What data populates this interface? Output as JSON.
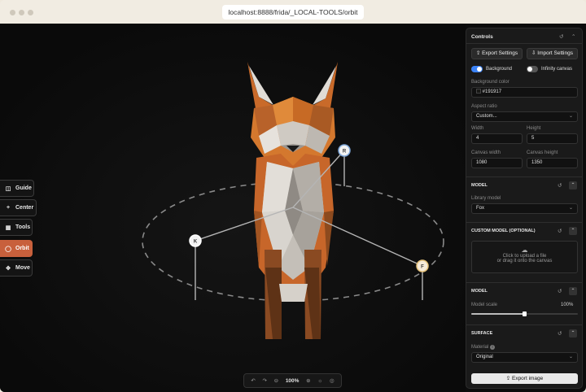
{
  "browser": {
    "url": "localhost:8888/frida/_LOCAL-TOOLS/orbit"
  },
  "toolbar": {
    "guide_label": "Guide",
    "center_label": "Center",
    "tools_label": "Tools",
    "orbit_label": "Orbit",
    "move_label": "Move",
    "active_tool": "Orbit"
  },
  "handles": {
    "r_label": "R",
    "k_label": "K",
    "f_label": "F"
  },
  "bottombar": {
    "zoom": "100%"
  },
  "panel": {
    "title": "Controls",
    "export_settings": "Export Settings",
    "import_settings": "Import Settings",
    "background_label": "Background",
    "background_on": true,
    "infinity_label": "Infinity canvas",
    "infinity_on": false,
    "bg_color_label": "Background color",
    "bg_color_value": "#191917",
    "aspect_label": "Aspect ratio",
    "aspect_value": "Custom...",
    "width_label": "Width",
    "width_value": "4",
    "height_label": "Height",
    "height_value": "5",
    "canvas_width_label": "Canvas width",
    "canvas_width_value": "1080",
    "canvas_height_label": "Canvas height",
    "canvas_height_value": "1350",
    "model_section": "MODEL",
    "library_label": "Library model",
    "library_value": "Fox",
    "custom_section": "CUSTOM MODEL (OPTIONAL)",
    "upload_line1": "Click to upload a file",
    "upload_line2": "or drag it onto the canvas",
    "model_section2": "MODEL",
    "scale_label": "Model scale",
    "scale_value": "100%",
    "scale_fraction": 0.5,
    "surface_section": "SURFACE",
    "material_label": "Material",
    "material_value": "Original",
    "export_image": "Export image"
  },
  "colors": {
    "accent": "#c8603c",
    "toggle_on": "#3b82f6",
    "canvas": "#0c0c0c",
    "panel": "#1a1a1a"
  }
}
